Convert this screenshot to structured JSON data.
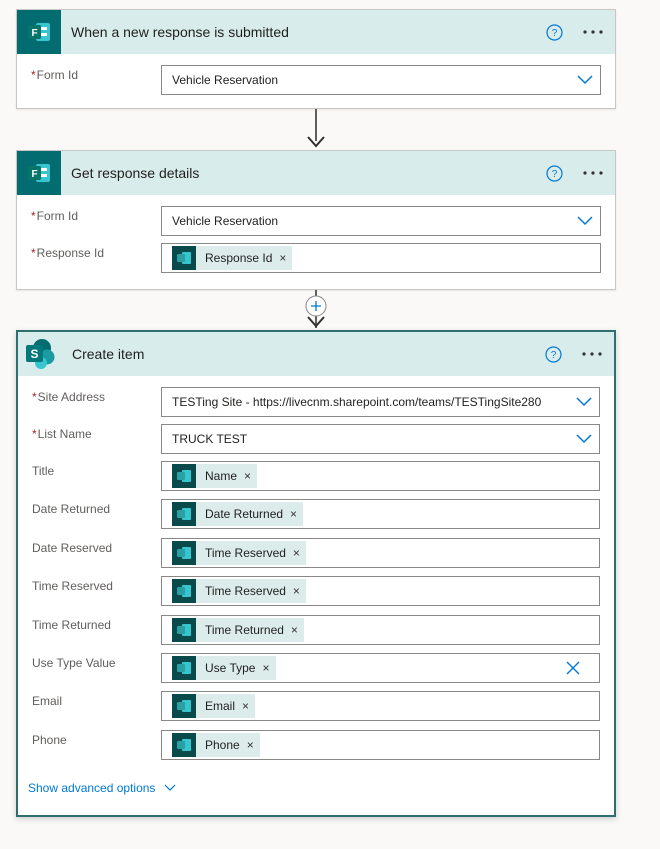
{
  "step1": {
    "title": "When a new response is submitted",
    "icon": "forms-icon",
    "form_id_label": "Form Id",
    "form_id_value": "Vehicle Reservation"
  },
  "step2": {
    "title": "Get response details",
    "icon": "forms-icon",
    "form_id_label": "Form Id",
    "form_id_value": "Vehicle Reservation",
    "response_id_label": "Response Id",
    "response_id_token": "Response Id"
  },
  "step3": {
    "title": "Create item",
    "icon": "sharepoint-icon",
    "site_address_label": "Site Address",
    "site_address_value": "TESTing Site - https://livecnm.sharepoint.com/teams/TESTingSite280",
    "list_name_label": "List Name",
    "list_name_value": "TRUCK TEST",
    "fields": [
      {
        "label": "Title",
        "token": "Name"
      },
      {
        "label": "Date Returned",
        "token": "Date Returned"
      },
      {
        "label": "Date Reserved",
        "token": "Time Reserved"
      },
      {
        "label": "Time Reserved",
        "token": "Time Reserved"
      },
      {
        "label": "Time Returned",
        "token": "Time Returned"
      },
      {
        "label": "Use Type Value",
        "token": "Use Type"
      },
      {
        "label": "Email",
        "token": "Email"
      },
      {
        "label": "Phone",
        "token": "Phone"
      }
    ],
    "advanced_label": "Show advanced options"
  },
  "required_marker": "*",
  "token_remove": "×",
  "colors": {
    "header_bg": "#d9ecec",
    "accent": "#0078d4",
    "selected_border": "#2e6e6e",
    "token_bg": "#dceceb",
    "required": "#a4262c"
  }
}
